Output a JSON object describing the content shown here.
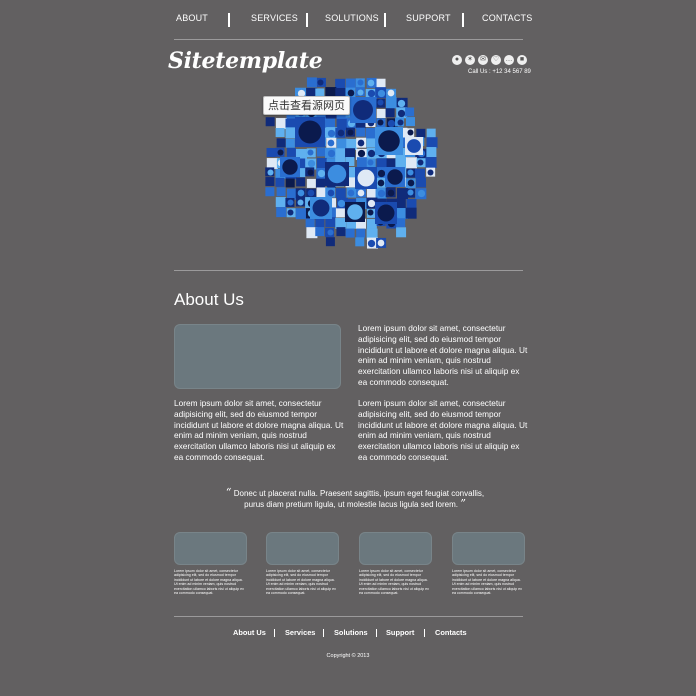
{
  "nav": {
    "items": [
      {
        "label": "ABOUT"
      },
      {
        "label": "SERVICES"
      },
      {
        "label": "SOLUTIONS"
      },
      {
        "label": "SUPPORT"
      },
      {
        "label": "CONTACTS"
      }
    ]
  },
  "header": {
    "logo": "Sitetemplate",
    "call": "Call Us : +12 34 567 89",
    "social_icons": [
      "user-icon",
      "share-icon",
      "mail-icon",
      "heart-icon",
      "rss-icon",
      "chat-icon"
    ]
  },
  "tooltip": "点击查看源网页",
  "about": {
    "title": "About Us",
    "para_top_right": "Lorem ipsum dolor sit amet, consectetur adipisicing elit, sed do eiusmod tempor incididunt ut labore et dolore magna aliqua. Ut enim ad minim veniam, quis nostrud exercitation ullamco laboris nisi ut aliquip ex ea commodo consequat.",
    "para_bottom_left": "Lorem ipsum dolor sit amet, consectetur adipisicing elit, sed do eiusmod tempor incididunt ut labore et dolore magna aliqua. Ut enim ad minim veniam, quis nostrud exercitation ullamco laboris nisi ut aliquip ex ea commodo consequat.",
    "para_bottom_right": "Lorem ipsum dolor sit amet, consectetur adipisicing elit, sed do eiusmod tempor incididunt ut labore et dolore magna aliqua. Ut enim ad minim veniam, quis nostrud exercitation ullamco laboris nisi ut aliquip ex ea commodo consequat."
  },
  "quote": {
    "line1": "Donec ut placerat nulla. Praesent sagittis, ipsum eget feugiat convallis,",
    "line2": "purus diam pretium ligula, ut molestie lacus ligula sed lorem."
  },
  "cards": [
    {
      "text": "Lorem ipsum dolor sit amet, consectetur adipisicing elit, sed do eiusmod tempor incididunt ut labore et dolore magna aliqua. Ut enim ad minim veniam, quis nostrud exercitation ullamco laboris nisi ut aliquip ex ea commodo consequat."
    },
    {
      "text": "Lorem ipsum dolor sit amet, consectetur adipisicing elit, sed do eiusmod tempor incididunt ut labore et dolore magna aliqua. Ut enim ad minim veniam, quis nostrud exercitation ullamco laboris nisi ut aliquip ex ea commodo consequat."
    },
    {
      "text": "Lorem ipsum dolor sit amet, consectetur adipisicing elit, sed do eiusmod tempor incididunt ut labore et dolore magna aliqua. Ut enim ad minim veniam, quis nostrud exercitation ullamco laboris nisi ut aliquip ex ea commodo consequat."
    },
    {
      "text": "Lorem ipsum dolor sit amet, consectetur adipisicing elit, sed do eiusmod tempor incididunt ut labore et dolore magna aliqua. Ut enim ad minim veniam, quis nostrud exercitation ullamco laboris nisi ut aliquip ex ea commodo consequat."
    }
  ],
  "footer": {
    "links": [
      {
        "label": "About Us"
      },
      {
        "label": "Services"
      },
      {
        "label": "Solutions"
      },
      {
        "label": "Support"
      },
      {
        "label": "Contacts"
      }
    ],
    "copyright": "Copyright © 2013"
  },
  "colors": {
    "background": "#626061",
    "placeholder": "#6b787e",
    "mosaic_palette": [
      "#0b1a4d",
      "#102b7a",
      "#1a4bb0",
      "#2a6ed0",
      "#3c8de0",
      "#5fb0ef",
      "#dfe9f5"
    ]
  }
}
